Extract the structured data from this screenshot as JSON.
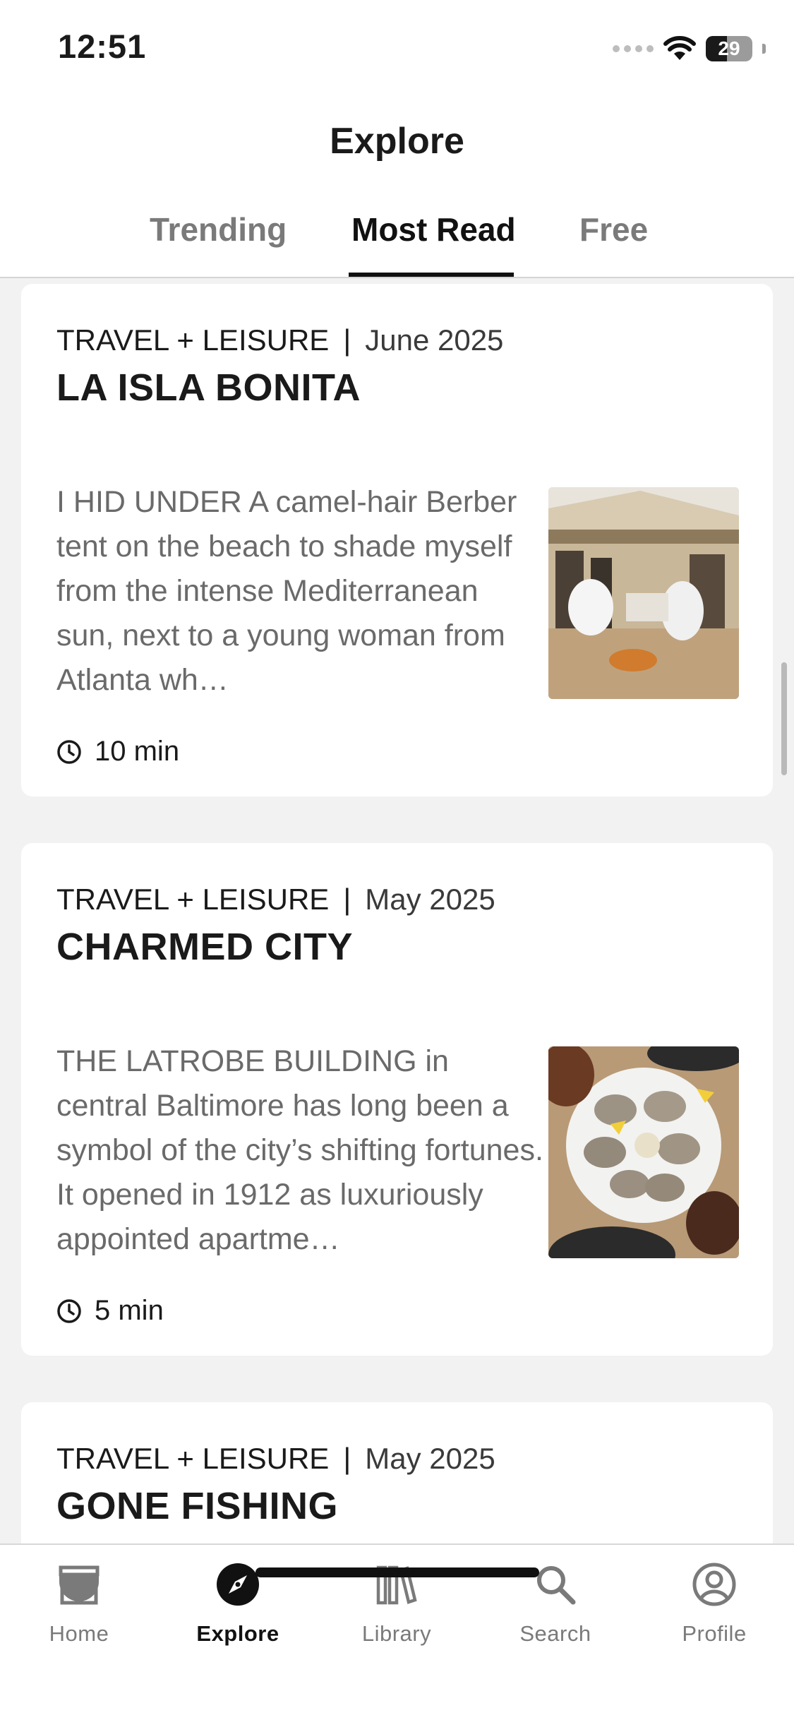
{
  "status_bar": {
    "time": "12:51",
    "battery": "29"
  },
  "header": {
    "title": "Explore",
    "tabs": [
      {
        "label": "Trending",
        "active": false
      },
      {
        "label": "Most Read",
        "active": true
      },
      {
        "label": "Free",
        "active": false
      }
    ]
  },
  "articles": [
    {
      "publication": "TRAVEL + LEISURE",
      "separator": "|",
      "date": "June 2025",
      "title": "LA ISLA BONITA",
      "excerpt": "I HID UNDER A camel-hair Berber tent on the beach to shade myself from the intense Mediterranean sun, next to a young woman from Atlanta wh…",
      "read_time": "10 min",
      "thumbnail": "beach-restaurant-photo"
    },
    {
      "publication": "TRAVEL + LEISURE",
      "separator": "|",
      "date": "May 2025",
      "title": "CHARMED CITY",
      "excerpt": "THE LATROBE BUILDING in central Baltimore has long been a symbol of the city’s shifting fortunes. It opened in 1912 as luxuriously appointed apartme…",
      "read_time": "5 min",
      "thumbnail": "oysters-platter-photo"
    },
    {
      "publication": "TRAVEL + LEISURE",
      "separator": "|",
      "date": "May 2025",
      "title": "GONE FISHING"
    }
  ],
  "bottom_nav": [
    {
      "label": "Home",
      "icon": "store-icon",
      "active": false
    },
    {
      "label": "Explore",
      "icon": "compass-icon",
      "active": true
    },
    {
      "label": "Library",
      "icon": "books-icon",
      "active": false
    },
    {
      "label": "Search",
      "icon": "search-icon",
      "active": false
    },
    {
      "label": "Profile",
      "icon": "profile-icon",
      "active": false
    }
  ],
  "colors": {
    "accent": "#111111",
    "inactive": "#7a7a7a",
    "excerpt": "#6a6a6a",
    "background": "#f2f2f2"
  }
}
